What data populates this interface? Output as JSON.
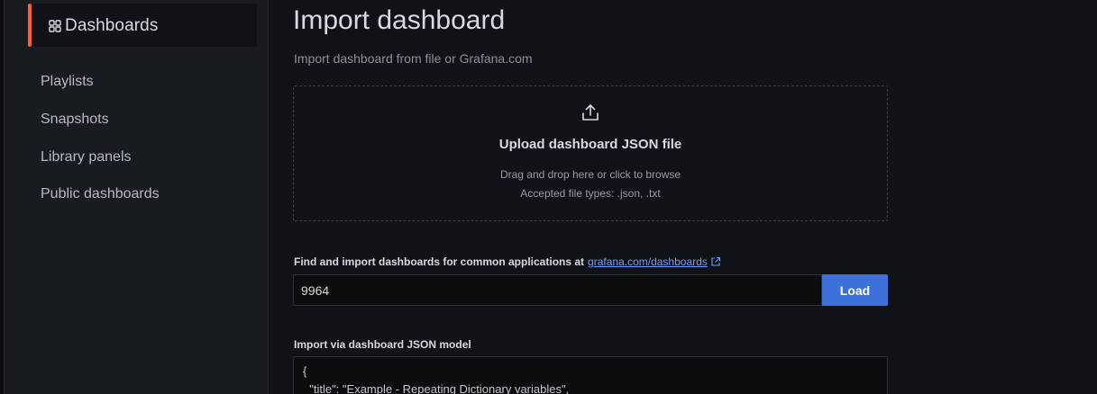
{
  "sidebar": {
    "active": {
      "label": "Dashboards",
      "icon": "grid-icon"
    },
    "items": [
      {
        "label": "Playlists"
      },
      {
        "label": "Snapshots"
      },
      {
        "label": "Library panels"
      },
      {
        "label": "Public dashboards"
      }
    ]
  },
  "page": {
    "title": "Import dashboard",
    "subtitle": "Import dashboard from file or Grafana.com"
  },
  "upload": {
    "title": "Upload dashboard JSON file",
    "hint": "Drag and drop here or click to browse",
    "accepted": "Accepted file types: .json, .txt",
    "icon": "upload-icon"
  },
  "grafana_com": {
    "label": "Find and import dashboards for common applications at",
    "link_text": "grafana.com/dashboards",
    "input_value": "9964",
    "load_label": "Load"
  },
  "json_model": {
    "label": "Import via dashboard JSON model",
    "lines": [
      "{",
      "  \"title\": \"Example - Repeating Dictionary variables\","
    ]
  },
  "colors": {
    "accent": "#ff5f2e",
    "primary_button": "#3d71d9",
    "link": "#6e9fff",
    "background": "#111217",
    "sidebar": "#181b1f"
  }
}
